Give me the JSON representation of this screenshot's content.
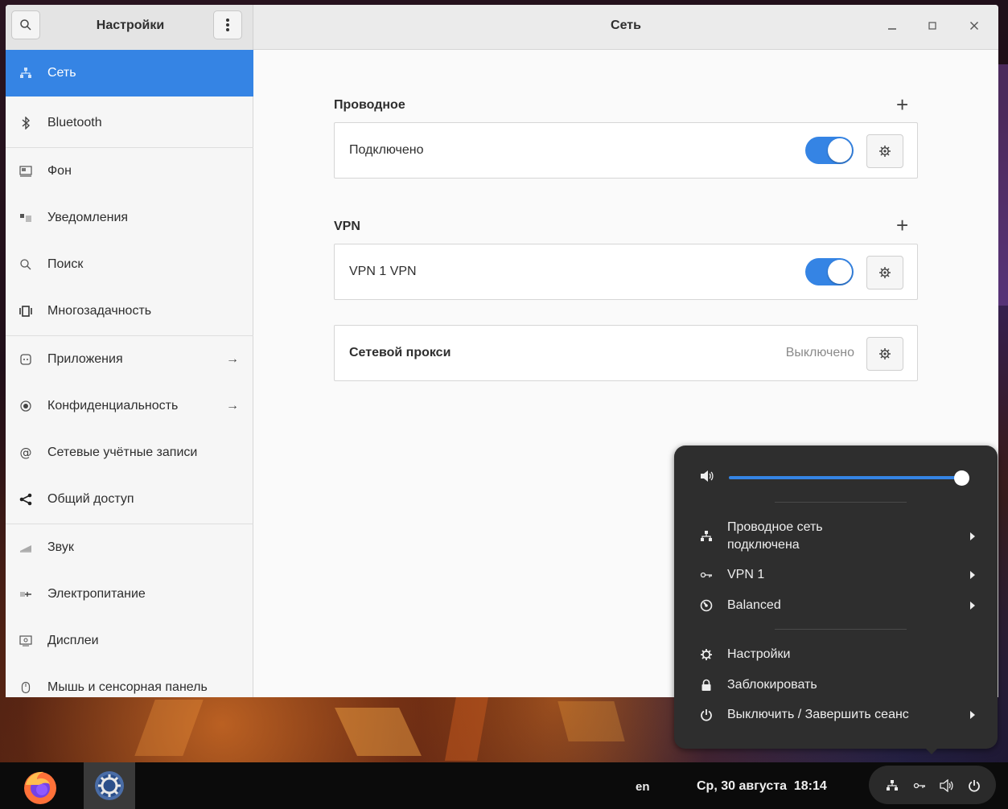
{
  "window": {
    "sidebar_title": "Настройки",
    "page_title": "Сеть",
    "controls": {
      "minimize": "_",
      "maximize": "□",
      "close": "✕"
    }
  },
  "sidebar": {
    "items": [
      {
        "label": "Сеть",
        "icon": "network-icon",
        "active": true,
        "arrow": ""
      },
      {
        "label": "Bluetooth",
        "icon": "bluetooth-icon",
        "active": false,
        "arrow": ""
      },
      {
        "label": "Фон",
        "icon": "background-icon",
        "active": false,
        "arrow": ""
      },
      {
        "label": "Уведомления",
        "icon": "notifications-icon",
        "active": false,
        "arrow": ""
      },
      {
        "label": "Поиск",
        "icon": "search-icon",
        "active": false,
        "arrow": ""
      },
      {
        "label": "Многозадачность",
        "icon": "multitasking-icon",
        "active": false,
        "arrow": ""
      },
      {
        "label": "Приложения",
        "icon": "apps-icon",
        "active": false,
        "arrow": "→"
      },
      {
        "label": "Конфиденциальность",
        "icon": "privacy-icon",
        "active": false,
        "arrow": "→"
      },
      {
        "label": "Сетевые учётные записи",
        "icon": "online-accounts-icon",
        "active": false,
        "arrow": ""
      },
      {
        "label": "Общий доступ",
        "icon": "sharing-icon",
        "active": false,
        "arrow": ""
      },
      {
        "label": "Звук",
        "icon": "sound-icon",
        "active": false,
        "arrow": ""
      },
      {
        "label": "Электропитание",
        "icon": "power-icon",
        "active": false,
        "arrow": ""
      },
      {
        "label": "Дисплеи",
        "icon": "displays-icon",
        "active": false,
        "arrow": ""
      },
      {
        "label": "Мышь и сенсорная панель",
        "icon": "mouse-icon",
        "active": false,
        "arrow": ""
      }
    ]
  },
  "main": {
    "wired": {
      "title": "Проводное",
      "add": "+",
      "connection_label": "Подключено",
      "toggle_on": true
    },
    "vpn": {
      "title": "VPN",
      "add": "+",
      "connection_label": "VPN 1 VPN",
      "toggle_on": true
    },
    "proxy": {
      "label": "Сетевой прокси",
      "status": "Выключено"
    }
  },
  "system_menu": {
    "volume_level": 1.0,
    "items": [
      {
        "label_line1": "Проводное сеть",
        "label_line2": "подключена",
        "icon": "wired-network-icon",
        "submenu": true
      },
      {
        "label_line1": "VPN 1",
        "icon": "vpn-icon",
        "submenu": true
      },
      {
        "label_line1": "Balanced",
        "icon": "power-profile-icon",
        "submenu": true
      },
      {
        "label_line1": "Настройки",
        "icon": "settings-gear-icon",
        "submenu": false
      },
      {
        "label_line1": "Заблокировать",
        "icon": "lock-icon",
        "submenu": false
      },
      {
        "label_line1": "Выключить / Завершить сеанс",
        "icon": "power-off-icon",
        "submenu": true
      }
    ]
  },
  "taskbar": {
    "keyboard_layout": "en",
    "clock": "Ср, 30 августа  18:14",
    "apps": [
      "firefox-icon",
      "settings-app-icon"
    ],
    "tray_icons": [
      "network-tray-icon",
      "vpn-tray-icon",
      "volume-tray-icon",
      "power-tray-icon"
    ]
  },
  "colors": {
    "accent": "#3584e4",
    "popover_bg": "#2e2e2e",
    "taskbar_bg": "#0b0b0b"
  }
}
